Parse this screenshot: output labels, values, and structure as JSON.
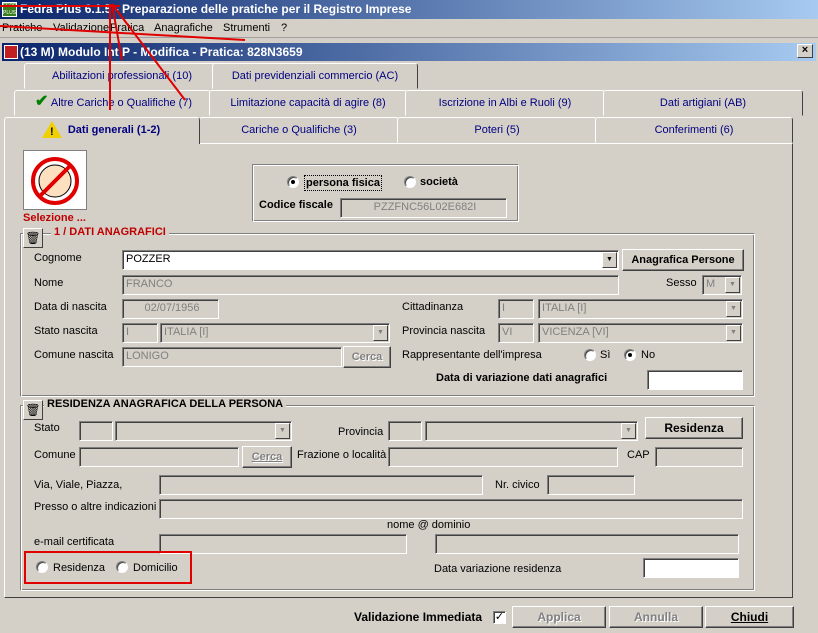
{
  "app": {
    "title": "Fedra Plus 6.1.5 - Preparazione delle pratiche per il Registro Imprese",
    "icon_text": "FEDRA PLUS"
  },
  "menu": [
    "Pratiche",
    "Validazione",
    "Pratica",
    "Anagrafiche",
    "Strumenti",
    "?"
  ],
  "window": {
    "title": "(13 M) Modulo Int P - Modifica - Pratica: 828N3659",
    "close": "×"
  },
  "tabs_row1": [
    "Abilitazioni professionali (10)",
    "Dati previdenziali commercio (AC)"
  ],
  "tabs_row2": [
    "Altre Cariche o Qualifiche (7)",
    "Limitazione capacità di agire (8)",
    "Iscrizione in Albi e Ruoli (9)",
    "Dati artigiani (AB)"
  ],
  "tabs_row3": [
    "Dati generali (1-2)",
    "Cariche o Qualifiche (3)",
    "Poteri (5)",
    "Conferimenti (6)"
  ],
  "selezione": "Selezione ...",
  "tipo": {
    "persona": "persona fisica",
    "societa": "società",
    "cf_label": "Codice fiscale",
    "cf_value": "PZZFNC56L02E682I"
  },
  "anagrafici": {
    "title": "1 / DATI ANAGRAFICI",
    "cognome_label": "Cognome",
    "cognome": "POZZER",
    "anagrafica_btn": "Anagrafica Persone",
    "nome_label": "Nome",
    "nome": "FRANCO",
    "sesso_label": "Sesso",
    "sesso": "M",
    "nascita_label": "Data di nascita",
    "nascita": "02/07/1956",
    "cittadinanza_label": "Cittadinanza",
    "citt_code": "I",
    "citt_value": "ITALIA [I]",
    "stato_label": "Stato nascita",
    "stato_code": "I",
    "stato_value": "ITALIA [I]",
    "prov_label": "Provincia nascita",
    "prov_code": "VI",
    "prov_value": "VICENZA [VI]",
    "comune_label": "Comune nascita",
    "comune": "LONIGO",
    "cerca": "Cerca",
    "rappr_label": "Rappresentante dell'impresa",
    "si": "Sì",
    "no": "No",
    "variaz_label": "Data di variazione dati anagrafici",
    "variaz": ""
  },
  "residenza": {
    "title": "RESIDENZA ANAGRAFICA DELLA PERSONA",
    "stato_label": "Stato",
    "provincia_label": "Provincia",
    "residenza_btn": "Residenza",
    "comune_label": "Comune",
    "cerca": "Cerca",
    "frazione_label": "Frazione o località",
    "cap_label": "CAP",
    "via_label": "Via, Viale, Piazza,",
    "civico_label": "Nr. civico",
    "presso_label": "Presso o altre indicazioni",
    "email_hint": "nome @  dominio",
    "email_label": "e-mail certificata",
    "opt_residenza": "Residenza",
    "opt_domicilio": "Domicilio",
    "variaz_label": "Data variazione residenza"
  },
  "footer": {
    "validazione": "Validazione Immediata",
    "applica": "Applica",
    "annulla": "Annulla",
    "chiudi": "Chiudi"
  }
}
